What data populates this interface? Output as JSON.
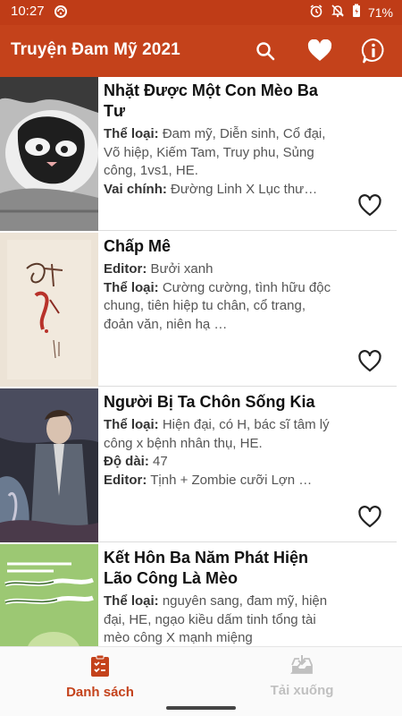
{
  "status_bar": {
    "time": "10:27",
    "battery": "71%"
  },
  "app_bar": {
    "title": "Truyện Đam Mỹ 2021",
    "actions": [
      "search-icon",
      "heart-icon",
      "info-icon"
    ]
  },
  "colors": {
    "primary": "#c4421b",
    "status": "#bf3c17",
    "inactive": "#c0c0c0"
  },
  "stories": [
    {
      "title": "Nhặt Được Một Con Mèo Ba Tư",
      "rows": [
        {
          "label": "Thể loại:",
          "value": "Đam mỹ, Diễn sinh, Cổ đại, Võ hiệp, Kiếm Tam, Truy phu, Sủng công, 1vs1, HE."
        },
        {
          "label": "Vai chính:",
          "value": "Đường Linh X Lục thư…"
        }
      ]
    },
    {
      "title": "Chấp Mê",
      "rows": [
        {
          "label": "Editor:",
          "value": "Bưởi xanh"
        },
        {
          "label": "Thể loại:",
          "value": "Cường cường, tình hữu độc chung, tiên hiệp tu chân, cổ trang, đoản văn, niên hạ …"
        }
      ]
    },
    {
      "title": "Người Bị Ta Chôn Sống Kia",
      "rows": [
        {
          "label": "Thể loại:",
          "value": "Hiện đại, có H, bác sĩ tâm lý công x bệnh nhân thụ, HE."
        },
        {
          "label": "Độ dài:",
          "value": "47"
        },
        {
          "label": "Editor:",
          "value": "Tịnh + Zombie cưỡi Lợn …"
        }
      ]
    },
    {
      "title": "Kết Hôn Ba Năm Phát Hiện Lão Công Là Mèo",
      "rows": [
        {
          "label": "Thể loại:",
          "value": "nguyên sang, đam mỹ, hiện đại, HE, ngạo kiều dấm tinh tổng tài mèo công X mạnh miệng"
        }
      ]
    }
  ],
  "bottom_nav": {
    "list_label": "Danh sách",
    "download_label": "Tải xuống"
  }
}
